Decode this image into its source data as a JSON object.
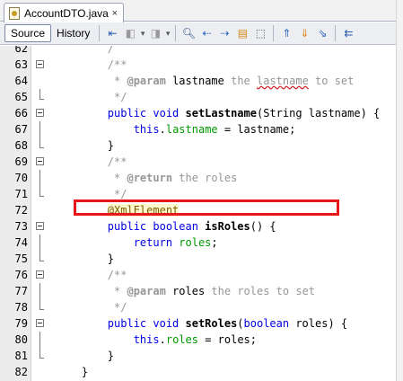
{
  "tab": {
    "title": "AccountDTO.java",
    "close": "×"
  },
  "toolbar": {
    "source_label": "Source",
    "history_label": "History"
  },
  "lines": [
    {
      "num": "62",
      "segments": [
        {
          "t": "        /",
          "c": "cmt"
        }
      ]
    },
    {
      "num": "63",
      "segments": [
        {
          "t": "        /**",
          "c": "cmt"
        }
      ]
    },
    {
      "num": "64",
      "segments": [
        {
          "t": "         * ",
          "c": "cmt"
        },
        {
          "t": "@param",
          "c": "tag"
        },
        {
          "t": " lastname",
          "c": ""
        },
        {
          "t": " the ",
          "c": "cmt"
        },
        {
          "t": "lastname",
          "c": "cmt squiggle"
        },
        {
          "t": " to set",
          "c": "cmt"
        }
      ]
    },
    {
      "num": "65",
      "segments": [
        {
          "t": "         */",
          "c": "cmt"
        }
      ]
    },
    {
      "num": "66",
      "segments": [
        {
          "t": "        ",
          "c": ""
        },
        {
          "t": "public void ",
          "c": "kw"
        },
        {
          "t": "setLastname",
          "c": "mtd"
        },
        {
          "t": "(String lastname) {",
          "c": ""
        }
      ]
    },
    {
      "num": "67",
      "segments": [
        {
          "t": "            ",
          "c": ""
        },
        {
          "t": "this",
          "c": "kw"
        },
        {
          "t": ".",
          "c": ""
        },
        {
          "t": "lastname",
          "c": "fld"
        },
        {
          "t": " = lastname;",
          "c": ""
        }
      ]
    },
    {
      "num": "68",
      "segments": [
        {
          "t": "        }",
          "c": ""
        }
      ]
    },
    {
      "num": "69",
      "segments": [
        {
          "t": "        /**",
          "c": "cmt"
        }
      ]
    },
    {
      "num": "70",
      "segments": [
        {
          "t": "         * ",
          "c": "cmt"
        },
        {
          "t": "@return",
          "c": "tag"
        },
        {
          "t": " the roles",
          "c": "cmt"
        }
      ]
    },
    {
      "num": "71",
      "segments": [
        {
          "t": "         */",
          "c": "cmt"
        }
      ]
    },
    {
      "num": "72",
      "segments": [
        {
          "t": "        ",
          "c": ""
        },
        {
          "t": "@XmlElement",
          "c": "ann"
        }
      ]
    },
    {
      "num": "73",
      "segments": [
        {
          "t": "        ",
          "c": ""
        },
        {
          "t": "public boolean ",
          "c": "kw"
        },
        {
          "t": "isRoles",
          "c": "mtd"
        },
        {
          "t": "() {",
          "c": ""
        }
      ]
    },
    {
      "num": "74",
      "segments": [
        {
          "t": "            ",
          "c": ""
        },
        {
          "t": "return ",
          "c": "kw"
        },
        {
          "t": "roles",
          "c": "fld"
        },
        {
          "t": ";",
          "c": ""
        }
      ]
    },
    {
      "num": "75",
      "segments": [
        {
          "t": "        }",
          "c": ""
        }
      ]
    },
    {
      "num": "76",
      "segments": [
        {
          "t": "        /**",
          "c": "cmt"
        }
      ]
    },
    {
      "num": "77",
      "segments": [
        {
          "t": "         * ",
          "c": "cmt"
        },
        {
          "t": "@param",
          "c": "tag"
        },
        {
          "t": " roles",
          "c": ""
        },
        {
          "t": " the roles to set",
          "c": "cmt"
        }
      ]
    },
    {
      "num": "78",
      "segments": [
        {
          "t": "         */",
          "c": "cmt"
        }
      ]
    },
    {
      "num": "79",
      "segments": [
        {
          "t": "        ",
          "c": ""
        },
        {
          "t": "public void ",
          "c": "kw"
        },
        {
          "t": "setRoles",
          "c": "mtd"
        },
        {
          "t": "(",
          "c": ""
        },
        {
          "t": "boolean",
          "c": "kw"
        },
        {
          "t": " roles) {",
          "c": ""
        }
      ]
    },
    {
      "num": "80",
      "segments": [
        {
          "t": "            ",
          "c": ""
        },
        {
          "t": "this",
          "c": "kw"
        },
        {
          "t": ".",
          "c": ""
        },
        {
          "t": "roles",
          "c": "fld"
        },
        {
          "t": " = roles;",
          "c": ""
        }
      ]
    },
    {
      "num": "81",
      "segments": [
        {
          "t": "        }",
          "c": ""
        }
      ]
    },
    {
      "num": "82",
      "segments": [
        {
          "t": "    }",
          "c": ""
        }
      ]
    }
  ],
  "folds": {
    "63": "open",
    "65": "end",
    "66": "open",
    "67": "mid",
    "68": "end",
    "69": "open",
    "70": "mid",
    "71": "end",
    "73": "open",
    "74": "mid",
    "75": "end",
    "76": "open",
    "77": "mid",
    "78": "end",
    "79": "open",
    "80": "mid",
    "81": "end"
  },
  "highlight": {
    "line": "72",
    "color": "#e8161a"
  }
}
